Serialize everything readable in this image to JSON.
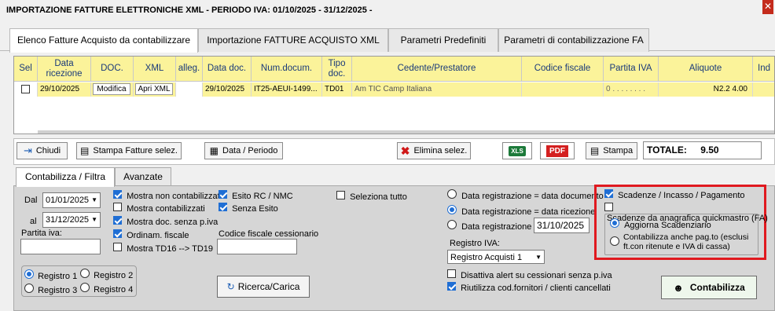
{
  "window": {
    "title": "IMPORTAZIONE FATTURE ELETTRONICHE XML - PERIODO IVA: 01/10/2025 - 31/12/2025 -"
  },
  "tabs": [
    "Elenco Fatture Acquisto da contabilizzare",
    "Importazione FATTURE ACQUISTO XML",
    "Parametri Predefiniti",
    "Parametri di contabilizzazione FA"
  ],
  "grid": {
    "headers": [
      "Sel",
      "Data ricezione",
      "DOC.",
      "XML",
      "alleg.",
      "Data doc.",
      "Num.docum.",
      "Tipo doc.",
      "Cedente/Prestatore",
      "Codice fiscale",
      "Partita IVA",
      "Aliquote",
      "Ind"
    ],
    "row": {
      "data_ricezione": "29/10/2025",
      "doc_button": "Modifica",
      "xml_button": "Apri XML",
      "data_doc": "29/10/2025",
      "num_docum": "IT25-AEUI-1499...",
      "tipo_doc": "TD01",
      "cedente": "Am       TIC           Camp      Italiana",
      "codice_fiscale": "",
      "partita_iva": "0 . . . . . . . .",
      "aliquote": "N2.2 4.00"
    }
  },
  "toolbar": {
    "chiudi": "Chiudi",
    "stampa_fatture": "Stampa Fatture selez.",
    "data_periodo": "Data / Periodo",
    "elimina": "Elimina selez.",
    "xls": "XLS",
    "pdf": "PDF",
    "stampa": "Stampa",
    "totale_label": "TOTALE:",
    "totale_value": "9.50"
  },
  "lower_tabs": [
    "Contabilizza / Filtra",
    "Avanzate"
  ],
  "filters": {
    "dal_label": "Dal",
    "dal_value": "01/01/2025",
    "al_label": "al",
    "al_value": "31/12/2025",
    "partita_iva_label": "Partita iva:",
    "partita_iva_value": "",
    "checks_col1": [
      {
        "label": "Mostra non contabilizzati",
        "checked": true
      },
      {
        "label": "Mostra contabilizzati",
        "checked": false
      },
      {
        "label": "Mostra doc. senza p.iva",
        "checked": true
      },
      {
        "label": "Ordinam. fiscale",
        "checked": true
      },
      {
        "label": "Mostra TD16 --> TD19",
        "checked": false
      }
    ],
    "checks_col2": [
      {
        "label": "Esito RC / NMC",
        "checked": true
      },
      {
        "label": "Senza Esito",
        "checked": true
      }
    ],
    "codice_fiscale_label": "Codice fiscale cessionario",
    "codice_fiscale_value": "",
    "seleziona_tutto": "Seleziona tutto",
    "registri": [
      {
        "label": "Registro 1",
        "selected": true
      },
      {
        "label": "Registro 2",
        "selected": false
      },
      {
        "label": "Registro 3",
        "selected": false
      },
      {
        "label": "Registro 4",
        "selected": false
      }
    ],
    "ricerca_button": "Ricerca/Carica"
  },
  "registration": {
    "options": [
      {
        "label": "Data registrazione = data documento",
        "selected": false
      },
      {
        "label": "Data registrazione = data ricezione",
        "selected": true
      },
      {
        "label": "Data registrazione =",
        "selected": false
      }
    ],
    "date_value": "31/10/2025",
    "registro_iva_label": "Registro IVA:",
    "registro_iva_value": "Registro Acquisti 1",
    "disattiva_alert": {
      "label": "Disattiva alert su cessionari senza p.iva",
      "checked": false
    },
    "riutilizza": {
      "label": "Riutilizza cod.fornitori / clienti cancellati",
      "checked": true
    }
  },
  "scadenze": {
    "scadenze_incasso": {
      "label": "Scadenze / Incasso / Pagamento",
      "checked": true
    },
    "scadenze_anagrafica": {
      "label": "Scadenze da anagrafica quickmastro (FA)",
      "checked": false
    },
    "aggiorna": {
      "label": "Aggiorna Scadenziario",
      "selected": true
    },
    "contabilizza_anche": {
      "label": "Contabilizza anche pag.to (esclusi ft.con ritenute e IVA di cassa)",
      "selected": false
    }
  },
  "contabilizza_button": "Contabilizza",
  "colors": {
    "header_yellow": "#fbf39a",
    "highlight_red": "#e0191f",
    "check_blue": "#1f6ed4"
  }
}
